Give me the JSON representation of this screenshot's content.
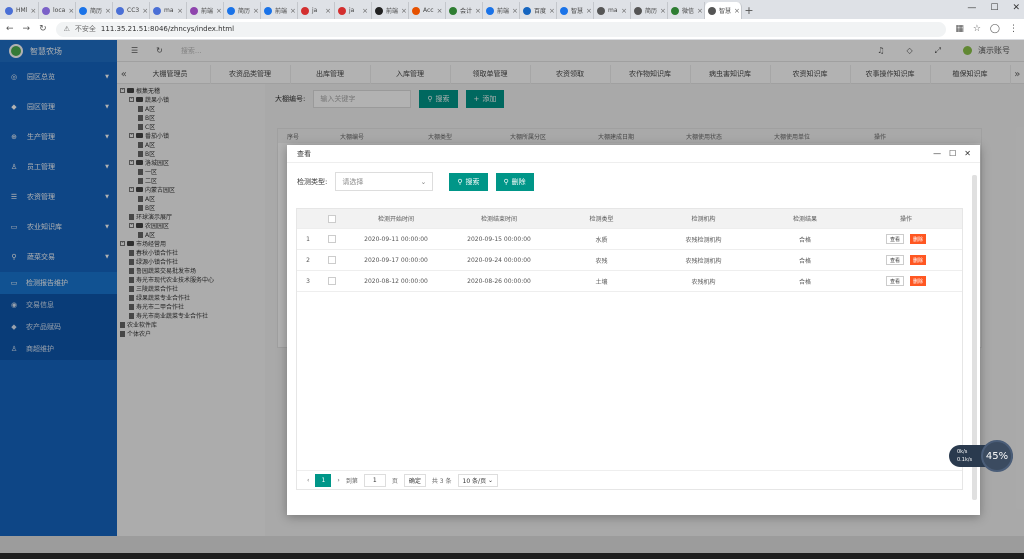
{
  "browser": {
    "tabs": [
      {
        "label": "HMl",
        "color": "#4a6fd6"
      },
      {
        "label": "loca",
        "color": "#7b61c8"
      },
      {
        "label": "简历",
        "color": "#1a73e8"
      },
      {
        "label": "CC3",
        "color": "#4a6fd6"
      },
      {
        "label": "ma",
        "color": "#4a6fd6"
      },
      {
        "label": "前端",
        "color": "#8e44ad"
      },
      {
        "label": "简历",
        "color": "#1a73e8"
      },
      {
        "label": "前端",
        "color": "#1a73e8"
      },
      {
        "label": "ja",
        "color": "#d32f2f"
      },
      {
        "label": "ja",
        "color": "#d32f2f"
      },
      {
        "label": "前端",
        "color": "#222222"
      },
      {
        "label": "Acc",
        "color": "#e65100"
      },
      {
        "label": "会计",
        "color": "#2e7d32"
      },
      {
        "label": "前端",
        "color": "#1a73e8"
      },
      {
        "label": "百度",
        "color": "#1565c0"
      },
      {
        "label": "智慧",
        "color": "#1a73e8"
      },
      {
        "label": "ma",
        "color": "#555555"
      },
      {
        "label": "简历",
        "color": "#555555"
      },
      {
        "label": "微信",
        "color": "#2e7d32"
      },
      {
        "label": "智慧",
        "color": "#555555"
      }
    ],
    "new_tab": "+",
    "insecure": "不安全",
    "url": "111.35.21.51:8046/zhncys/index.html"
  },
  "sidebar": {
    "logo_text": "智慧农场",
    "items": [
      {
        "label": "园区总览",
        "icon": "◎"
      },
      {
        "label": "园区管理",
        "icon": "◆"
      },
      {
        "label": "生产管理",
        "icon": "⊕"
      },
      {
        "label": "员工管理",
        "icon": "♙"
      },
      {
        "label": "农资管理",
        "icon": "☰"
      },
      {
        "label": "农业知识库",
        "icon": "▭"
      },
      {
        "label": "蔬菜交易",
        "icon": "⚲"
      }
    ],
    "sub_items": [
      {
        "label": "检测报告维护",
        "icon": "▭"
      },
      {
        "label": "交易信息",
        "icon": "◉"
      },
      {
        "label": "农产品赋码",
        "icon": "◆"
      },
      {
        "label": "商超维护",
        "icon": "♙"
      }
    ]
  },
  "topbar": {
    "search_placeholder": "搜索...",
    "user": "演示账号"
  },
  "page_tabs": [
    "大棚管理员",
    "农资品类管理",
    "出库管理",
    "入库管理",
    "领取单管理",
    "农资领取",
    "农作物知识库",
    "病虫害知识库",
    "农资知识库",
    "农事操作知识库",
    "植保知识库"
  ],
  "tree": [
    {
      "label": "根集无稽",
      "level": 0,
      "kind": "folder"
    },
    {
      "label": "蔬果小镇",
      "level": 1,
      "kind": "folder"
    },
    {
      "label": "A区",
      "level": 2,
      "kind": "doc"
    },
    {
      "label": "B区",
      "level": 2,
      "kind": "doc"
    },
    {
      "label": "C区",
      "level": 2,
      "kind": "doc"
    },
    {
      "label": "番茄小镇",
      "level": 1,
      "kind": "folder"
    },
    {
      "label": "A区",
      "level": 2,
      "kind": "doc"
    },
    {
      "label": "B区",
      "level": 2,
      "kind": "doc"
    },
    {
      "label": "洛城园区",
      "level": 1,
      "kind": "folder"
    },
    {
      "label": "一区",
      "level": 2,
      "kind": "doc"
    },
    {
      "label": "二区",
      "level": 2,
      "kind": "doc"
    },
    {
      "label": "内蒙古园区",
      "level": 1,
      "kind": "folder"
    },
    {
      "label": "A区",
      "level": 2,
      "kind": "doc"
    },
    {
      "label": "B区",
      "level": 2,
      "kind": "doc"
    },
    {
      "label": "环球演示展厅",
      "level": 1,
      "kind": "doc"
    },
    {
      "label": "农园园区",
      "level": 1,
      "kind": "folder"
    },
    {
      "label": "A区",
      "level": 2,
      "kind": "doc"
    },
    {
      "label": "市场经营用",
      "level": 0,
      "kind": "folder"
    },
    {
      "label": "春秋小镇合作社",
      "level": 1,
      "kind": "doc"
    },
    {
      "label": "绿源小镇合作社",
      "level": 1,
      "kind": "doc"
    },
    {
      "label": "鲁园蔬菜交易批发市场",
      "level": 1,
      "kind": "doc"
    },
    {
      "label": "寿光市现代农业技术服务中心",
      "level": 1,
      "kind": "doc"
    },
    {
      "label": "三陵蔬菜合作社",
      "level": 1,
      "kind": "doc"
    },
    {
      "label": "绿果蔬菜专业合作社",
      "level": 1,
      "kind": "doc"
    },
    {
      "label": "寿光市二甲合作社",
      "level": 1,
      "kind": "doc"
    },
    {
      "label": "寿光市商业蔬菜专业合作社",
      "level": 1,
      "kind": "doc"
    },
    {
      "label": "农业软件库",
      "level": 0,
      "kind": "doc"
    },
    {
      "label": "个体农户",
      "level": 0,
      "kind": "doc"
    }
  ],
  "background": {
    "filter_label": "大棚编号:",
    "filter_placeholder": "输入关键字",
    "search_btn": "搜索",
    "add_btn": "添加",
    "columns": [
      "序号",
      "大棚编号",
      "大棚类型",
      "大棚所属分区",
      "大棚建成日期",
      "大棚使用状态",
      "大棚使用单位",
      "操作"
    ]
  },
  "modal": {
    "title": "查看",
    "filter_label": "检测类型:",
    "select_value": "请选择",
    "search_btn": "搜索",
    "delete_btn": "删除",
    "columns": [
      "检测开始时间",
      "检测结束时间",
      "检测类型",
      "检测机构",
      "检测结果",
      "操作"
    ],
    "rows": [
      {
        "no": "1",
        "start": "2020-09-11 00:00:00",
        "end": "2020-09-15 00:00:00",
        "type": "水质",
        "org": "农残检测机构",
        "result": "合格"
      },
      {
        "no": "2",
        "start": "2020-09-17 00:00:00",
        "end": "2020-09-24 00:00:00",
        "type": "农残",
        "org": "农残检测机构",
        "result": "合格"
      },
      {
        "no": "3",
        "start": "2020-08-12 00:00:00",
        "end": "2020-08-26 00:00:00",
        "type": "土壤",
        "org": "农残机构",
        "result": "合格"
      }
    ],
    "view_btn": "查看",
    "row_delete_btn": "删除",
    "pager": {
      "goto": "到第",
      "page_input": "1",
      "page_unit": "页",
      "confirm": "确定",
      "total": "共 3 条",
      "page_size": "10 条/页",
      "current": "1"
    }
  },
  "widget": {
    "up": "0k/s",
    "down": "0.1k/s",
    "percent": "45%"
  }
}
